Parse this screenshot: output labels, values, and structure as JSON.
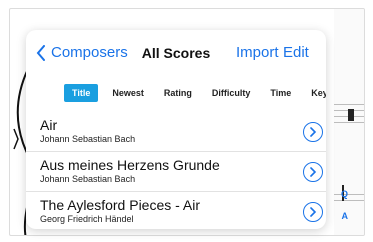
{
  "header": {
    "back_label": "Composers",
    "title": "All Scores",
    "import_label": "Import",
    "edit_label": "Edit"
  },
  "tabs": [
    {
      "label": "Title",
      "active": true
    },
    {
      "label": "Newest",
      "active": false
    },
    {
      "label": "Rating",
      "active": false
    },
    {
      "label": "Difficulty",
      "active": false
    },
    {
      "label": "Time",
      "active": false
    },
    {
      "label": "Key",
      "active": false
    }
  ],
  "scores": [
    {
      "title": "Air",
      "composer": "Johann Sebastian Bach"
    },
    {
      "title": "Aus meines Herzens Grunde",
      "composer": "Johann Sebastian Bach"
    },
    {
      "title": "The Aylesford Pieces - Air",
      "composer": "Georg Friedrich Händel"
    }
  ],
  "side_index": {
    "search": "Q",
    "letter": "A"
  },
  "colors": {
    "accent": "#1a73e8",
    "tab_active": "#1a9fe0"
  },
  "icons": {
    "back": "chevron-left-icon",
    "disclosure": "chevron-right-circle-icon"
  }
}
